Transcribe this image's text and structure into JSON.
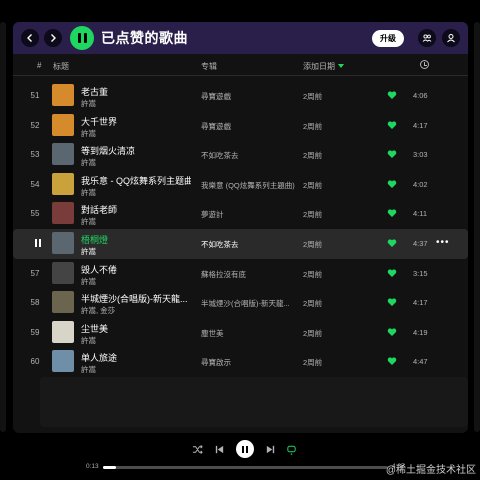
{
  "header": {
    "title": "已点赞的歌曲",
    "upgrade_label": "升级"
  },
  "columns": {
    "num": "#",
    "title": "标题",
    "album": "专辑",
    "date_added": "添加日期"
  },
  "tracks": [
    {
      "num": "51",
      "title": "老古董",
      "artist": "許嵩",
      "album": "尋寶遊戲",
      "date": "2周前",
      "duration": "4:06",
      "art_color": "#d58a2b"
    },
    {
      "num": "52",
      "title": "大千世界",
      "artist": "許嵩",
      "album": "尋寶遊戲",
      "date": "2周前",
      "duration": "4:17",
      "art_color": "#d58a2b"
    },
    {
      "num": "53",
      "title": "等到烟火清凉",
      "artist": "許嵩",
      "album": "不如吃茶去",
      "date": "2周前",
      "duration": "3:03",
      "art_color": "#5a6770"
    },
    {
      "num": "54",
      "title": "我乐意 - QQ炫舞系列主题曲",
      "artist": "許嵩",
      "album": "我樂意 (QQ炫舞系列主題曲)",
      "date": "2周前",
      "duration": "4:02",
      "art_color": "#c9a23b"
    },
    {
      "num": "55",
      "title": "對話老師",
      "artist": "許嵩",
      "album": "夢遊計",
      "date": "2周前",
      "duration": "4:11",
      "art_color": "#7a3b3b"
    },
    {
      "num": "",
      "title": "梧桐燈",
      "artist": "許嵩",
      "album": "不如吃茶去",
      "date": "2周前",
      "duration": "4:37",
      "art_color": "#5a6770",
      "active": true
    },
    {
      "num": "57",
      "title": "毁人不倦",
      "artist": "許嵩",
      "album": "蘇格拉沒有底",
      "date": "2周前",
      "duration": "3:15",
      "art_color": "#444444"
    },
    {
      "num": "58",
      "title": "半城煙沙(合唱版)-新天龍...",
      "artist": "許嵩, 金莎",
      "album": "半城煙沙(合唱版)-新天龍...",
      "date": "2周前",
      "duration": "4:17",
      "art_color": "#6b6550"
    },
    {
      "num": "59",
      "title": "尘世美",
      "artist": "許嵩",
      "album": "塵世美",
      "date": "2周前",
      "duration": "4:19",
      "art_color": "#d9d4c8"
    },
    {
      "num": "60",
      "title": "单人旅途",
      "artist": "許嵩",
      "album": "尋寶啟示",
      "date": "2周前",
      "duration": "4:47",
      "art_color": "#6f8fa8"
    }
  ],
  "player": {
    "elapsed": "0:13",
    "total": "4:37",
    "progress": 0.047
  },
  "watermark": "@稀土掘金技术社区",
  "colors": {
    "accent": "#1ed760",
    "header_bg": "#2a1f4a",
    "panel_bg": "#121212"
  }
}
